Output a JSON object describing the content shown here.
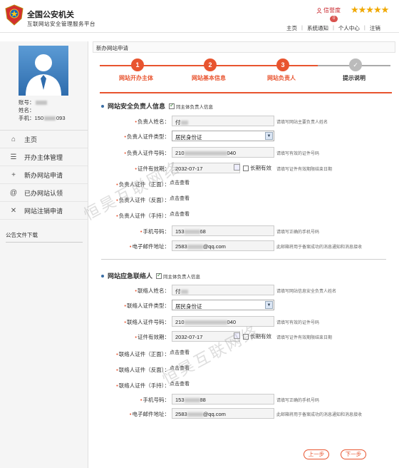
{
  "header": {
    "title": "全国公安机关",
    "subtitle": "互联网站安全管理服务平台",
    "credit_label": "信誉度",
    "credit_badge": "0",
    "stars": "★★★★★",
    "nav": [
      "主页",
      "系统通知",
      "个人中心",
      "注销"
    ]
  },
  "sidebar": {
    "account_label": "账号：",
    "name_label": "姓名：",
    "phone_label": "手机：",
    "phone_prefix": "150",
    "phone_suffix": "093",
    "menu": [
      {
        "label": "主页",
        "icon": "home-icon",
        "glyph": "⌂"
      },
      {
        "label": "开办主体管理",
        "icon": "list-icon",
        "glyph": "☰"
      },
      {
        "label": "新办网站申请",
        "icon": "plus-icon",
        "glyph": "+"
      },
      {
        "label": "已办网站认领",
        "icon": "at-icon",
        "glyph": "@"
      },
      {
        "label": "网站注销申请",
        "icon": "close-icon",
        "glyph": "✕"
      }
    ],
    "notice": "公告文件下载"
  },
  "main": {
    "breadcrumb": "新办网站申请",
    "steps": [
      {
        "num": "1",
        "label": "网站开办主体",
        "state": "done"
      },
      {
        "num": "2",
        "label": "网站基本信息",
        "state": "done"
      },
      {
        "num": "3",
        "label": "网站负责人",
        "state": "done"
      },
      {
        "num": "✓",
        "label": "提示说明",
        "state": "pending"
      }
    ]
  },
  "security": {
    "title": "网站安全负责人信息",
    "same_label": "同主体负责人信息",
    "fields": {
      "name": {
        "label": "负责人姓名：",
        "value": "付",
        "hint": "请填写网站主要负责人姓名"
      },
      "id_type": {
        "label": "负责人证件类型：",
        "value": "居民身份证"
      },
      "id_no": {
        "label": "负责人证件号码：",
        "prefix": "210",
        "suffix": "040",
        "hint": "请填写有效的证件号码"
      },
      "expiry": {
        "label": "证件有效期：",
        "value": "2032-07-17",
        "long_label": "长期有效",
        "hint": "请填写证件有效期限结束日期"
      },
      "id_front": {
        "label": "负责人证件（正面）：",
        "action": "点击查看"
      },
      "id_back": {
        "label": "负责人证件（反面）：",
        "action": "点击查看"
      },
      "id_hand": {
        "label": "负责人证件（手持）：",
        "action": "点击查看"
      },
      "phone": {
        "label": "手机号码：",
        "prefix": "153",
        "suffix": "68",
        "hint": "请填写正确的手机号码"
      },
      "email": {
        "label": "电子邮件地址：",
        "prefix": "2583",
        "suffix": "@qq.com",
        "hint": "此邮箱将用于备案成功的消息通知和消息接收"
      }
    }
  },
  "emergency": {
    "title": "网站应急联络人",
    "same_label": "同主体负责人信息",
    "fields": {
      "name": {
        "label": "联络人姓名：",
        "value": "付",
        "hint": "请填写网站信息安全负责人姓名"
      },
      "id_type": {
        "label": "联络人证件类型：",
        "value": "居民身份证"
      },
      "id_no": {
        "label": "联络人证件号码：",
        "prefix": "210",
        "suffix": "040",
        "hint": "请填写有效的证件号码"
      },
      "expiry": {
        "label": "证件有效期：",
        "value": "2032-07-17",
        "long_label": "长期有效",
        "hint": "请填写证件有效期限结束日期"
      },
      "id_front": {
        "label": "联络人证件（正面）：",
        "action": "点击查看"
      },
      "id_back": {
        "label": "联络人证件（反面）：",
        "action": "点击查看"
      },
      "id_hand": {
        "label": "联络人证件（手持）：",
        "action": "点击查看"
      },
      "phone": {
        "label": "手机号码：",
        "prefix": "153",
        "suffix": "88",
        "hint": "请填写正确的手机号码"
      },
      "email": {
        "label": "电子邮件地址：",
        "prefix": "2583",
        "suffix": "@qq.com",
        "hint": "此邮箱将用于备案成功的消息通知和消息接收"
      }
    }
  },
  "buttons": {
    "prev": "上一步",
    "next": "下一步"
  },
  "watermark": [
    "恒昊互联网络",
    "恒昊互联网络"
  ]
}
